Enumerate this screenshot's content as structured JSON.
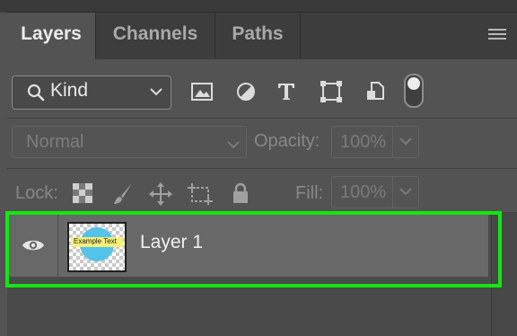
{
  "tabs": [
    {
      "label": "Layers",
      "active": true
    },
    {
      "label": "Channels",
      "active": false
    },
    {
      "label": "Paths",
      "active": false
    }
  ],
  "filter": {
    "kind_label": "Kind",
    "icons": [
      "image-filter-icon",
      "adjustment-filter-icon",
      "type-filter-icon",
      "shape-filter-icon",
      "smart-object-filter-icon"
    ],
    "toggle_on": true
  },
  "blend": {
    "mode": "Normal",
    "opacity_label": "Opacity:",
    "opacity_value": "100%"
  },
  "lock": {
    "label": "Lock:",
    "fill_label": "Fill:",
    "fill_value": "100%"
  },
  "layers": [
    {
      "name": "Layer 1",
      "visible": true,
      "thumbnail_text": "Example Text"
    }
  ],
  "colors": {
    "highlight": "#14e614",
    "thumb_circle": "#53c3e9",
    "thumb_band": "#f4f07a",
    "panel_bg": "#535353"
  }
}
